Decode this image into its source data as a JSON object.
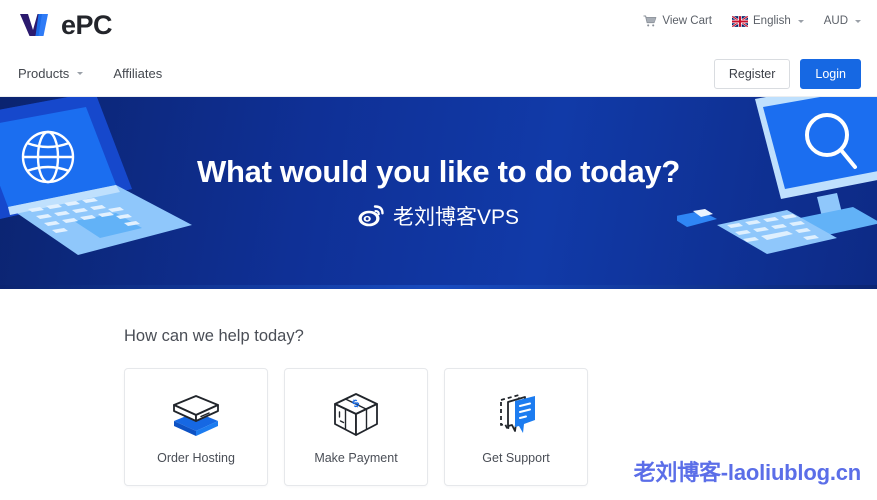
{
  "brand": {
    "logo_text": "ePC",
    "logo_mark_colors": {
      "left": "#2b1a6e",
      "right": "#2f7bf6"
    }
  },
  "topbar": {
    "cart_label": "View Cart",
    "cart_icon": "shopping-cart-icon",
    "language_label": "English",
    "language_flag_icon": "uk-flag-icon",
    "currency_label": "AUD"
  },
  "nav": {
    "links": [
      {
        "label": "Products",
        "has_dropdown": true
      },
      {
        "label": "Affiliates",
        "has_dropdown": false
      }
    ],
    "register_label": "Register",
    "login_label": "Login",
    "login_color": "#1668e3"
  },
  "hero": {
    "title": "What would you like to do today?",
    "watermark_text": "老刘博客VPS",
    "watermark_icon": "weibo-icon",
    "bg_color": "#0f3096",
    "left_art": "isometric-laptop-globe-illustration",
    "right_art": "isometric-desktop-search-illustration"
  },
  "help": {
    "title": "How can we help today?",
    "cards": [
      {
        "label": "Order Hosting",
        "icon": "stacked-server-box-icon"
      },
      {
        "label": "Make Payment",
        "icon": "dollar-cube-box-icon"
      },
      {
        "label": "Get Support",
        "icon": "chat-bubbles-icon"
      }
    ]
  },
  "watermark": {
    "text": "老刘博客-laoliublog.cn",
    "color": "#5b6ee8"
  }
}
